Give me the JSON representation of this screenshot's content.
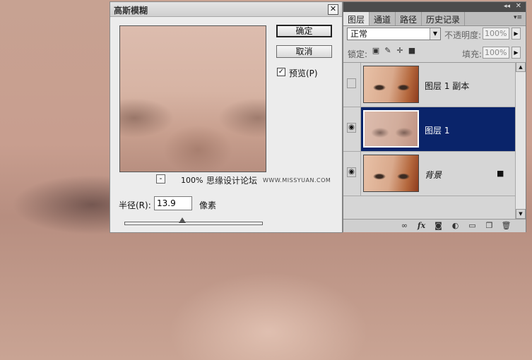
{
  "dialog": {
    "title": "高斯模糊",
    "close_glyph": "✕",
    "ok_label": "确定",
    "cancel_label": "取消",
    "preview_check": "✓",
    "preview_label": "预览(P)",
    "zoom_out": "-",
    "zoom_percent": "100%",
    "watermark_cn": "思缘设计论坛",
    "watermark_url": "WWW.MISSYUAN.COM",
    "radius_label": "半径(R):",
    "radius_value": "13.9",
    "radius_unit": "像素",
    "radius_slider_fraction": 0.42
  },
  "panel": {
    "collapse_glyph": "◂◂",
    "close_glyph": "✕",
    "tabs": [
      "图层",
      "通道",
      "路径",
      "历史记录"
    ],
    "active_tab": "图层",
    "menu_glyph": "▾≡",
    "blend_mode": "正常",
    "opacity_label": "不透明度:",
    "opacity_value": "100%",
    "lock_label": "锁定:",
    "fill_label": "填充:",
    "fill_value": "100%",
    "layers": [
      {
        "name": "图层 1 副本",
        "visible": false,
        "selected": false
      },
      {
        "name": "图层 1",
        "visible": true,
        "selected": true
      },
      {
        "name": "背景",
        "visible": true,
        "selected": false,
        "locked": true
      }
    ],
    "eye_glyph": "◉",
    "lock_glyph": "🔒"
  },
  "colors": {
    "selection": "#0a246a",
    "panel_bg": "#d6d6d6",
    "dialog_bg": "#ececec"
  }
}
